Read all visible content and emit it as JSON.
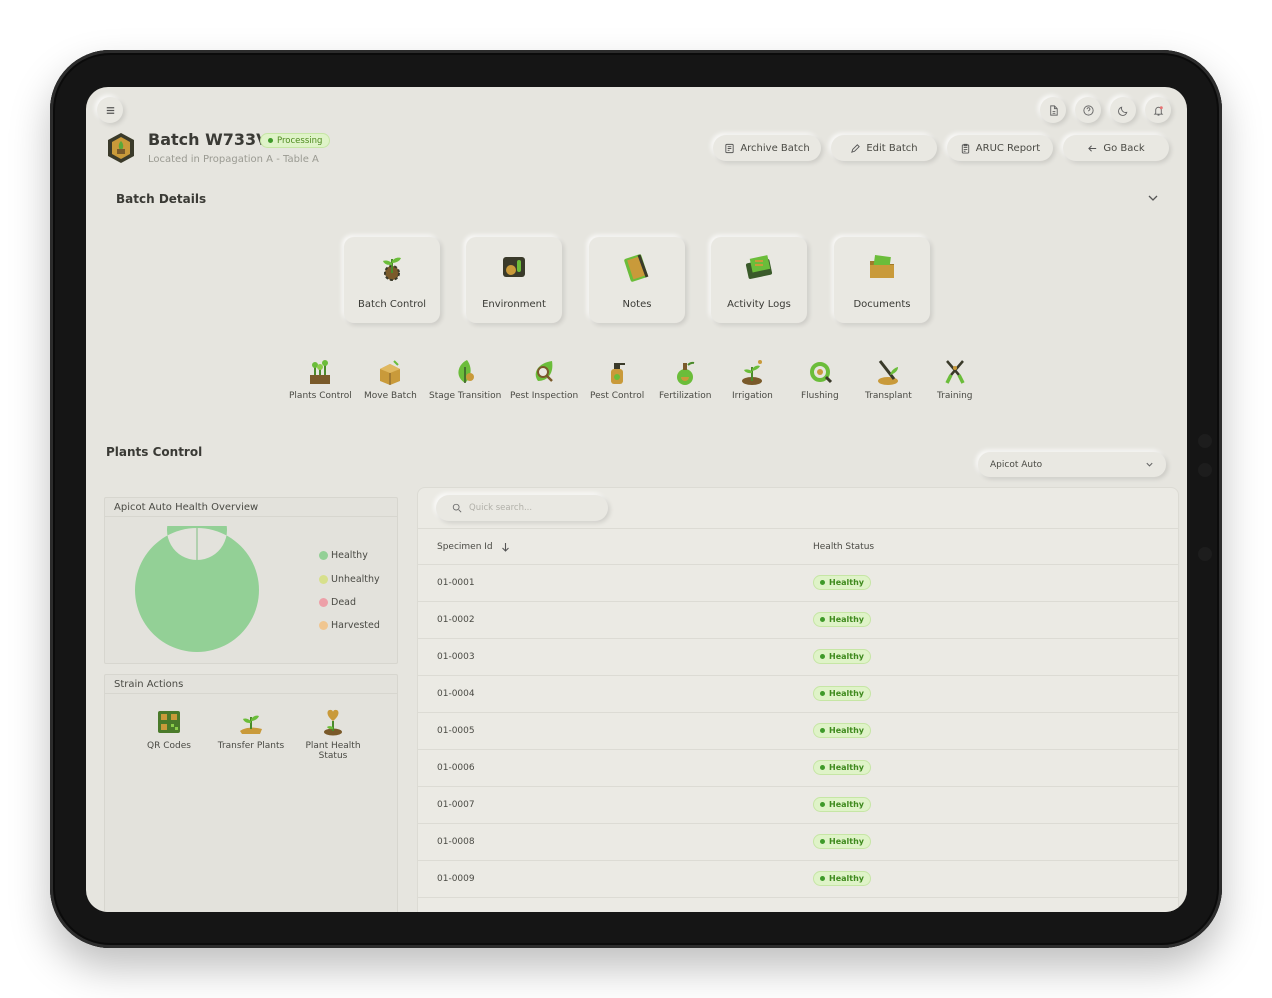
{
  "header": {
    "batch_title": "Batch W733V",
    "status_badge": "Processing",
    "location": "Located in Propagation A - Table A",
    "actions": {
      "archive": "Archive Batch",
      "edit": "Edit Batch",
      "aruc": "ARUC Report",
      "back": "Go Back"
    }
  },
  "batch_details": {
    "title": "Batch Details",
    "tiles": [
      "Batch Control",
      "Environment",
      "Notes",
      "Activity Logs",
      "Documents"
    ],
    "actions": [
      "Plants Control",
      "Move Batch",
      "Stage Transition",
      "Pest Inspection",
      "Pest Control",
      "Fertilization",
      "Irrigation",
      "Flushing",
      "Transplant",
      "Training"
    ]
  },
  "plants_control": {
    "title": "Plants Control",
    "strain_select": "Apicot Auto",
    "health_overview": {
      "title": "Apicot Auto Health Overview",
      "legend": [
        "Healthy",
        "Unhealthy",
        "Dead",
        "Harvested"
      ],
      "colors": {
        "healthy": "#93d096",
        "unhealthy": "#d7e08c",
        "dead": "#eda0a8",
        "harvested": "#f0c690"
      }
    },
    "chart_data": {
      "type": "pie",
      "categories": [
        "Healthy",
        "Unhealthy",
        "Dead",
        "Harvested"
      ],
      "values": [
        100,
        0,
        0,
        0
      ]
    },
    "strain_actions": {
      "title": "Strain Actions",
      "items": [
        "QR Codes",
        "Transfer Plants",
        "Plant Health Status"
      ]
    },
    "table": {
      "search_placeholder": "Quick search...",
      "headers": {
        "specimen": "Specimen Id",
        "health": "Health Status"
      },
      "rows": [
        {
          "id": "01-0001",
          "status": "Healthy"
        },
        {
          "id": "01-0002",
          "status": "Healthy"
        },
        {
          "id": "01-0003",
          "status": "Healthy"
        },
        {
          "id": "01-0004",
          "status": "Healthy"
        },
        {
          "id": "01-0005",
          "status": "Healthy"
        },
        {
          "id": "01-0006",
          "status": "Healthy"
        },
        {
          "id": "01-0007",
          "status": "Healthy"
        },
        {
          "id": "01-0008",
          "status": "Healthy"
        },
        {
          "id": "01-0009",
          "status": "Healthy"
        }
      ]
    }
  }
}
